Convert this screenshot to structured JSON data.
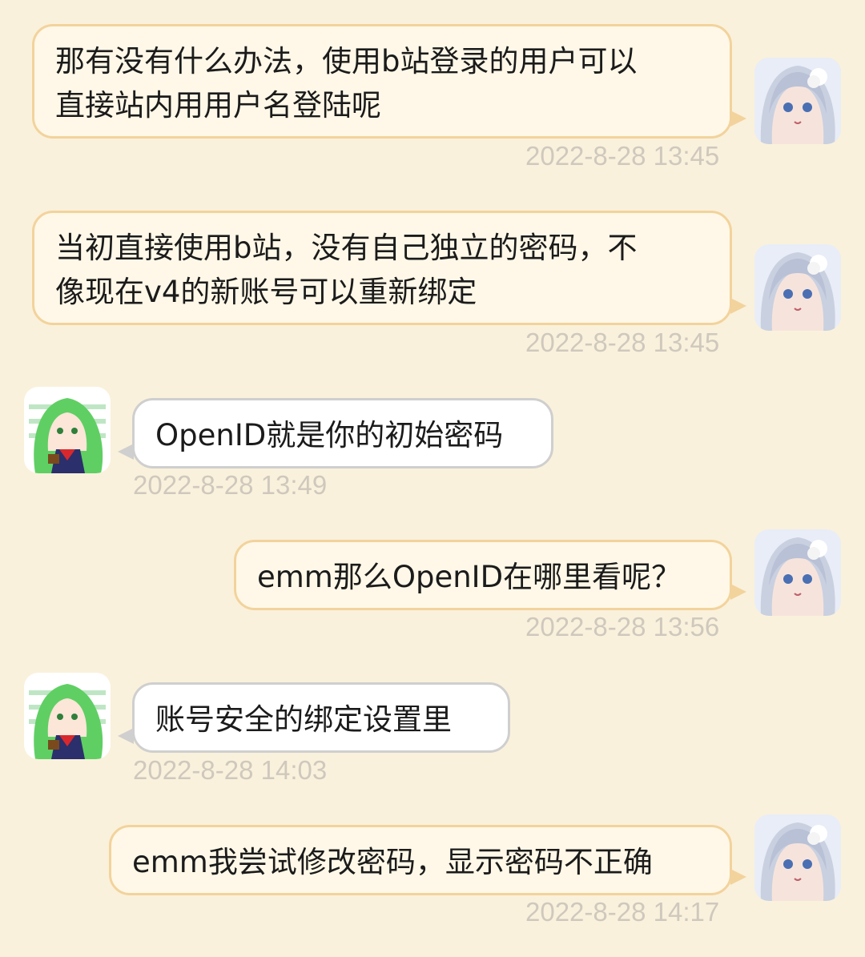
{
  "messages": [
    {
      "side": "out",
      "text": "那有没有什么办法，使用b站登录的用户可以\n直接站内用用户名登陆呢",
      "time": "2022-8-28 13:45",
      "avatar": "silver-haired-anime-girl-avatar"
    },
    {
      "side": "out",
      "text": "当初直接使用b站，没有自己独立的密码，不\n像现在v4的新账号可以重新绑定",
      "time": "2022-8-28 13:45",
      "avatar": "silver-haired-anime-girl-avatar"
    },
    {
      "side": "in",
      "text": "OpenID就是你的初始密码",
      "time": "2022-8-28 13:49",
      "avatar": "green-haired-anime-girl-avatar"
    },
    {
      "side": "out",
      "text": "emm那么OpenID在哪里看呢？",
      "time": "2022-8-28 13:56",
      "avatar": "silver-haired-anime-girl-avatar"
    },
    {
      "side": "in",
      "text": "账号安全的绑定设置里",
      "time": "2022-8-28 14:03",
      "avatar": "green-haired-anime-girl-avatar"
    },
    {
      "side": "out",
      "text": "emm我尝试修改密码，显示密码不正确",
      "time": "2022-8-28 14:17",
      "avatar": "silver-haired-anime-girl-avatar"
    }
  ],
  "colors": {
    "background": "#faf1dc",
    "outgoing_bubble": "#fff8e8",
    "outgoing_border": "#f2d39c",
    "incoming_bubble": "#ffffff",
    "incoming_border": "#cfcfcf",
    "timestamp": "#cfc8bd"
  }
}
